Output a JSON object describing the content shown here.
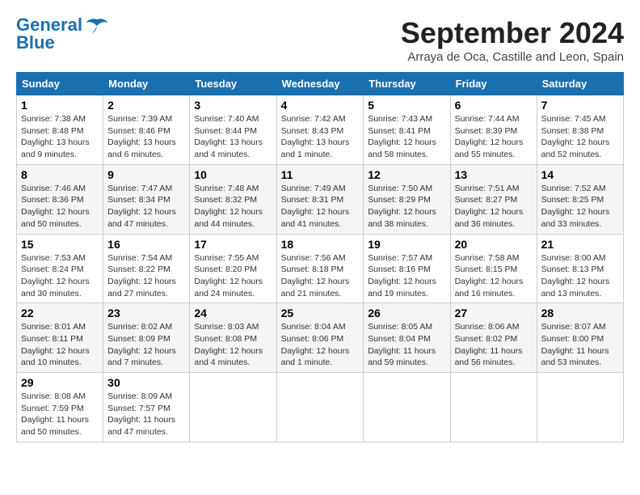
{
  "logo": {
    "part1": "General",
    "part2": "Blue"
  },
  "header": {
    "month": "September 2024",
    "location": "Arraya de Oca, Castille and Leon, Spain"
  },
  "weekdays": [
    "Sunday",
    "Monday",
    "Tuesday",
    "Wednesday",
    "Thursday",
    "Friday",
    "Saturday"
  ],
  "weeks": [
    [
      {
        "day": "1",
        "info": "Sunrise: 7:38 AM\nSunset: 8:48 PM\nDaylight: 13 hours\nand 9 minutes."
      },
      {
        "day": "2",
        "info": "Sunrise: 7:39 AM\nSunset: 8:46 PM\nDaylight: 13 hours\nand 6 minutes."
      },
      {
        "day": "3",
        "info": "Sunrise: 7:40 AM\nSunset: 8:44 PM\nDaylight: 13 hours\nand 4 minutes."
      },
      {
        "day": "4",
        "info": "Sunrise: 7:42 AM\nSunset: 8:43 PM\nDaylight: 13 hours\nand 1 minute."
      },
      {
        "day": "5",
        "info": "Sunrise: 7:43 AM\nSunset: 8:41 PM\nDaylight: 12 hours\nand 58 minutes."
      },
      {
        "day": "6",
        "info": "Sunrise: 7:44 AM\nSunset: 8:39 PM\nDaylight: 12 hours\nand 55 minutes."
      },
      {
        "day": "7",
        "info": "Sunrise: 7:45 AM\nSunset: 8:38 PM\nDaylight: 12 hours\nand 52 minutes."
      }
    ],
    [
      {
        "day": "8",
        "info": "Sunrise: 7:46 AM\nSunset: 8:36 PM\nDaylight: 12 hours\nand 50 minutes."
      },
      {
        "day": "9",
        "info": "Sunrise: 7:47 AM\nSunset: 8:34 PM\nDaylight: 12 hours\nand 47 minutes."
      },
      {
        "day": "10",
        "info": "Sunrise: 7:48 AM\nSunset: 8:32 PM\nDaylight: 12 hours\nand 44 minutes."
      },
      {
        "day": "11",
        "info": "Sunrise: 7:49 AM\nSunset: 8:31 PM\nDaylight: 12 hours\nand 41 minutes."
      },
      {
        "day": "12",
        "info": "Sunrise: 7:50 AM\nSunset: 8:29 PM\nDaylight: 12 hours\nand 38 minutes."
      },
      {
        "day": "13",
        "info": "Sunrise: 7:51 AM\nSunset: 8:27 PM\nDaylight: 12 hours\nand 36 minutes."
      },
      {
        "day": "14",
        "info": "Sunrise: 7:52 AM\nSunset: 8:25 PM\nDaylight: 12 hours\nand 33 minutes."
      }
    ],
    [
      {
        "day": "15",
        "info": "Sunrise: 7:53 AM\nSunset: 8:24 PM\nDaylight: 12 hours\nand 30 minutes."
      },
      {
        "day": "16",
        "info": "Sunrise: 7:54 AM\nSunset: 8:22 PM\nDaylight: 12 hours\nand 27 minutes."
      },
      {
        "day": "17",
        "info": "Sunrise: 7:55 AM\nSunset: 8:20 PM\nDaylight: 12 hours\nand 24 minutes."
      },
      {
        "day": "18",
        "info": "Sunrise: 7:56 AM\nSunset: 8:18 PM\nDaylight: 12 hours\nand 21 minutes."
      },
      {
        "day": "19",
        "info": "Sunrise: 7:57 AM\nSunset: 8:16 PM\nDaylight: 12 hours\nand 19 minutes."
      },
      {
        "day": "20",
        "info": "Sunrise: 7:58 AM\nSunset: 8:15 PM\nDaylight: 12 hours\nand 16 minutes."
      },
      {
        "day": "21",
        "info": "Sunrise: 8:00 AM\nSunset: 8:13 PM\nDaylight: 12 hours\nand 13 minutes."
      }
    ],
    [
      {
        "day": "22",
        "info": "Sunrise: 8:01 AM\nSunset: 8:11 PM\nDaylight: 12 hours\nand 10 minutes."
      },
      {
        "day": "23",
        "info": "Sunrise: 8:02 AM\nSunset: 8:09 PM\nDaylight: 12 hours\nand 7 minutes."
      },
      {
        "day": "24",
        "info": "Sunrise: 8:03 AM\nSunset: 8:08 PM\nDaylight: 12 hours\nand 4 minutes."
      },
      {
        "day": "25",
        "info": "Sunrise: 8:04 AM\nSunset: 8:06 PM\nDaylight: 12 hours\nand 1 minute."
      },
      {
        "day": "26",
        "info": "Sunrise: 8:05 AM\nSunset: 8:04 PM\nDaylight: 11 hours\nand 59 minutes."
      },
      {
        "day": "27",
        "info": "Sunrise: 8:06 AM\nSunset: 8:02 PM\nDaylight: 11 hours\nand 56 minutes."
      },
      {
        "day": "28",
        "info": "Sunrise: 8:07 AM\nSunset: 8:00 PM\nDaylight: 11 hours\nand 53 minutes."
      }
    ],
    [
      {
        "day": "29",
        "info": "Sunrise: 8:08 AM\nSunset: 7:59 PM\nDaylight: 11 hours\nand 50 minutes."
      },
      {
        "day": "30",
        "info": "Sunrise: 8:09 AM\nSunset: 7:57 PM\nDaylight: 11 hours\nand 47 minutes."
      },
      {
        "day": "",
        "info": ""
      },
      {
        "day": "",
        "info": ""
      },
      {
        "day": "",
        "info": ""
      },
      {
        "day": "",
        "info": ""
      },
      {
        "day": "",
        "info": ""
      }
    ]
  ]
}
